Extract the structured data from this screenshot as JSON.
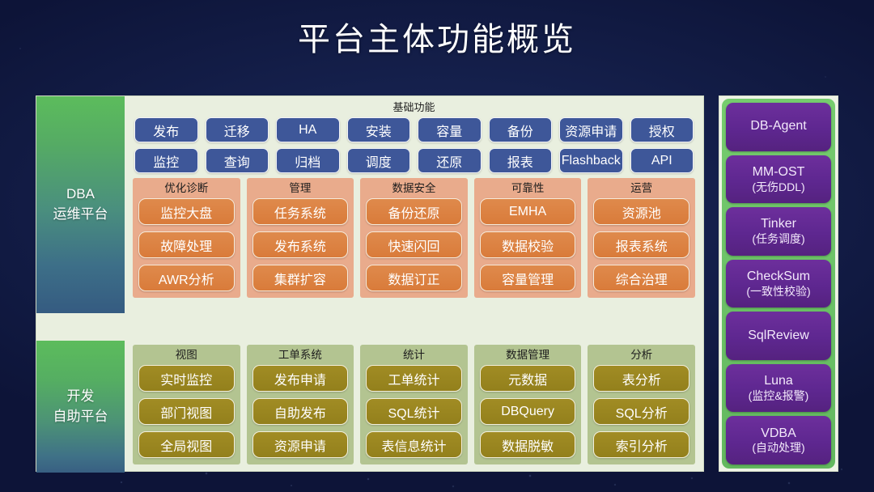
{
  "slide": {
    "title": "平台主体功能概览",
    "accent_dark_bg": "#15204c",
    "accent_blue_button": "#3e5799",
    "accent_orange": "#d97b3a",
    "accent_olive": "#93801c",
    "accent_purple": "#5e2790",
    "accent_green": "#6cc267"
  },
  "dba_platform": {
    "side_label_line1": "DBA",
    "side_label_line2": "运维平台",
    "basic": {
      "caption": "基础功能",
      "buttons": [
        "发布",
        "迁移",
        "HA",
        "安装",
        "容量",
        "备份",
        "资源申请",
        "授权",
        "监控",
        "查询",
        "归档",
        "调度",
        "还原",
        "报表",
        "Flashback",
        "API"
      ]
    },
    "categories": [
      {
        "title": "优化诊断",
        "items": [
          "监控大盘",
          "故障处理",
          "AWR分析"
        ]
      },
      {
        "title": "管理",
        "items": [
          "任务系统",
          "发布系统",
          "集群扩容"
        ]
      },
      {
        "title": "数据安全",
        "items": [
          "备份还原",
          "快速闪回",
          "数据订正"
        ]
      },
      {
        "title": "可靠性",
        "items": [
          "EMHA",
          "数据校验",
          "容量管理"
        ]
      },
      {
        "title": "运营",
        "items": [
          "资源池",
          "报表系统",
          "综合治理"
        ]
      }
    ]
  },
  "dev_platform": {
    "side_label_line1": "开发",
    "side_label_line2": "自助平台",
    "categories": [
      {
        "title": "视图",
        "items": [
          "实时监控",
          "部门视图",
          "全局视图"
        ]
      },
      {
        "title": "工单系统",
        "items": [
          "发布申请",
          "自助发布",
          "资源申请"
        ]
      },
      {
        "title": "统计",
        "items": [
          "工单统计",
          "SQL统计",
          "表信息统计"
        ]
      },
      {
        "title": "数据管理",
        "items": [
          "元数据",
          "DBQuery",
          "数据脱敏"
        ]
      },
      {
        "title": "分析",
        "items": [
          "表分析",
          "SQL分析",
          "索引分析"
        ]
      }
    ]
  },
  "components": [
    {
      "name": "DB-Agent",
      "sub": ""
    },
    {
      "name": "MM-OST",
      "sub": "(无伤DDL)"
    },
    {
      "name": "Tinker",
      "sub": "(任务调度)"
    },
    {
      "name": "CheckSum",
      "sub": "(一致性校验)"
    },
    {
      "name": "SqlReview",
      "sub": ""
    },
    {
      "name": "Luna",
      "sub": "(监控&报警)"
    },
    {
      "name": "VDBA",
      "sub": "(自动处理)"
    }
  ]
}
